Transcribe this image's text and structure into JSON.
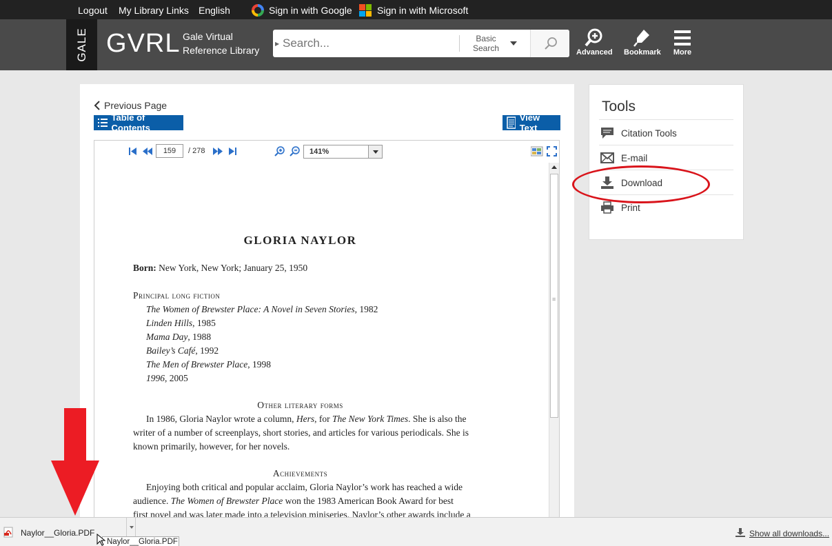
{
  "topbar": {
    "logout": "Logout",
    "library_links": "My Library Links",
    "language": "English",
    "google": "Sign in with Google",
    "microsoft": "Sign in with Microsoft"
  },
  "header": {
    "brand_vertical": "GALE",
    "brand": "GVRL",
    "brand_sub": "Gale Virtual Reference Library",
    "search_placeholder": "Search...",
    "search_type": "Basic Search",
    "advanced": "Advanced",
    "bookmark": "Bookmark",
    "more": "More"
  },
  "nav": {
    "previous_page": "Previous Page",
    "toc": "Table of Contents",
    "view_text": "View Text"
  },
  "viewer": {
    "current_page": "159",
    "total_pages": "/ 278",
    "zoom": "141%"
  },
  "document": {
    "title": "GLORIA NAYLOR",
    "born_label": "Born:",
    "born_value": " New York, New York; January 25, 1950",
    "fiction_heading": "Principal long fiction",
    "works": [
      {
        "title": "The Women of Brewster Place: A Novel in Seven Stories",
        "year": ", 1982"
      },
      {
        "title": "Linden Hills",
        "year": ", 1985"
      },
      {
        "title": "Mama Day",
        "year": ", 1988"
      },
      {
        "title": "Bailey’s Café",
        "year": ", 1992"
      },
      {
        "title": "The Men of Brewster Place",
        "year": ", 1998"
      },
      {
        "title": "1996",
        "year": ", 2005"
      }
    ],
    "other_heading": "Other literary forms",
    "other_l1a": "In 1986, Gloria Naylor wrote a column, ",
    "other_l1b": "Hers",
    "other_l1c": ", for ",
    "other_l1d": "The New York Times",
    "other_l1e": ". She is also the",
    "other_l2": "writer of a number of screenplays, short stories, and articles for various periodicals. She is",
    "other_l3": "known primarily, however, for her novels.",
    "ach_heading": "Achievements",
    "ach_l1": "Enjoying both critical and popular acclaim, Gloria Naylor’s work has reached a wide",
    "ach_l2a": "audience. ",
    "ach_l2b": "The Women of Brewster Place",
    "ach_l2c": " won the 1983 American Book Award for best",
    "ach_l3": "first novel and was later made into a television miniseries. Naylor’s other awards include a"
  },
  "tools": {
    "title": "Tools",
    "items": [
      "Citation Tools",
      "E-mail",
      "Download",
      "Print"
    ]
  },
  "downloads": {
    "file_name": "Naylor__Gloria.PDF",
    "tooltip": "Naylor__Gloria.PDF",
    "show_all": "Show all downloads..."
  },
  "colors": {
    "accent_blue": "#0b5ea8",
    "annotation_red": "#d9141b"
  }
}
